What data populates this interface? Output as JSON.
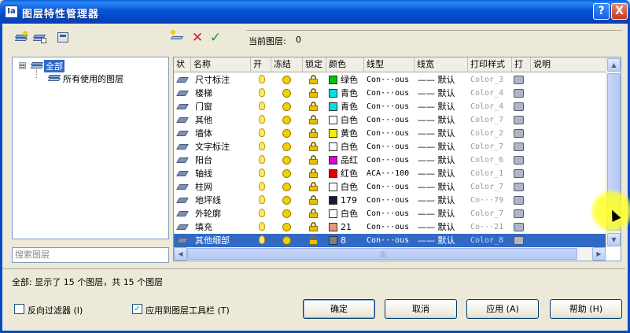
{
  "window": {
    "title": "图层特性管理器",
    "help_glyph": "?",
    "close_glyph": "X",
    "icon_text": "Ia"
  },
  "toolbar": {
    "icons": [
      "new-filter-icon",
      "layer-states-icon",
      "group-filter-icon",
      "new-layer-icon",
      "delete-layer-icon",
      "set-current-icon"
    ]
  },
  "current": {
    "label": "当前图层:",
    "value": "0"
  },
  "tree": {
    "expander": "⊟",
    "root": "全部",
    "child": "所有使用的图层"
  },
  "search": {
    "placeholder": "搜索图层"
  },
  "table": {
    "headers": [
      "状",
      "名称",
      "开",
      "冻结",
      "锁定",
      "颜色",
      "线型",
      "线宽",
      "打印样式",
      "打",
      "说明"
    ],
    "rows": [
      {
        "name": "尺寸标注",
        "color": "绿色",
        "swatch": "#00c800",
        "linetype": "Con···ous",
        "lineweight": "—— 默认",
        "style": "Color_3"
      },
      {
        "name": "楼梯",
        "color": "青色",
        "swatch": "#00e0e0",
        "linetype": "Con···ous",
        "lineweight": "—— 默认",
        "style": "Color_4"
      },
      {
        "name": "门窗",
        "color": "青色",
        "swatch": "#00e0e0",
        "linetype": "Con···ous",
        "lineweight": "—— 默认",
        "style": "Color_4"
      },
      {
        "name": "其他",
        "color": "白色",
        "swatch": "#ffffff",
        "linetype": "Con···ous",
        "lineweight": "—— 默认",
        "style": "Color_7"
      },
      {
        "name": "墙体",
        "color": "黄色",
        "swatch": "#f0f000",
        "linetype": "Con···ous",
        "lineweight": "—— 默认",
        "style": "Color_2"
      },
      {
        "name": "文字标注",
        "color": "白色",
        "swatch": "#ffffff",
        "linetype": "Con···ous",
        "lineweight": "—— 默认",
        "style": "Color_7"
      },
      {
        "name": "阳台",
        "color": "品红",
        "swatch": "#e000e0",
        "linetype": "Con···ous",
        "lineweight": "—— 默认",
        "style": "Color_6"
      },
      {
        "name": "轴线",
        "color": "红色",
        "swatch": "#e00000",
        "linetype": "ACA···100",
        "lineweight": "—— 默认",
        "style": "Color_1"
      },
      {
        "name": "柱网",
        "color": "白色",
        "swatch": "#ffffff",
        "linetype": "Con···ous",
        "lineweight": "—— 默认",
        "style": "Color_7"
      },
      {
        "name": "地坪线",
        "color": "179",
        "swatch": "#1a1a30",
        "linetype": "Con···ous",
        "lineweight": "—— 默认",
        "style": "Co···79"
      },
      {
        "name": "外轮廓",
        "color": "白色",
        "swatch": "#ffffff",
        "linetype": "Con···ous",
        "lineweight": "—— 默认",
        "style": "Color_7"
      },
      {
        "name": "填充",
        "color": "21",
        "swatch": "#e89878",
        "linetype": "Con···ous",
        "lineweight": "—— 默认",
        "style": "Co···21"
      },
      {
        "name": "其他细部",
        "color": "8",
        "swatch": "#808080",
        "linetype": "Con···ous",
        "lineweight": "—— 默认",
        "style": "Color_8",
        "selected": true
      }
    ]
  },
  "status": {
    "text": "全部: 显示了 15 个图层，共 15 个图层"
  },
  "options": {
    "invert_filter": "反向过滤器 (I)",
    "apply_toolbar": "应用到图层工具栏 (T)",
    "checkmark": "✓"
  },
  "buttons": {
    "ok": "确定",
    "cancel": "取消",
    "apply": "应用 (A)",
    "help": "帮助 (H)"
  },
  "scroll": {
    "up": "▲",
    "down": "▼",
    "left": "◀",
    "right": "▶",
    "grip": "|||"
  }
}
